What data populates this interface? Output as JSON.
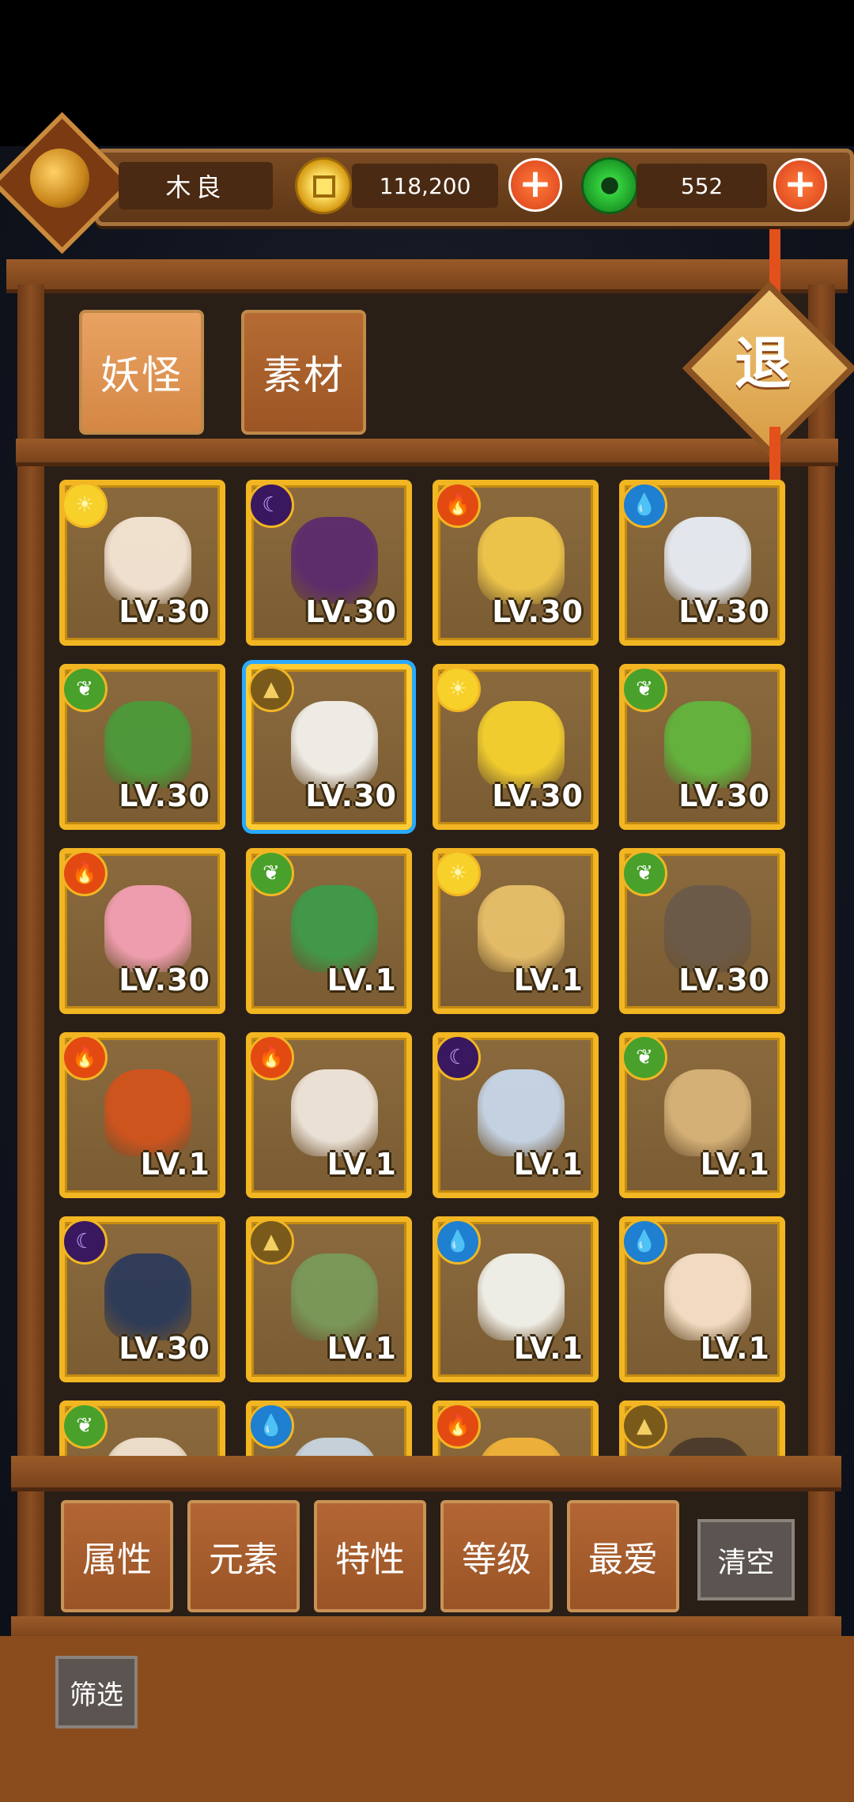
{
  "player": {
    "name": "木良"
  },
  "currencies": {
    "gold": {
      "icon": "gold-coin-icon",
      "value": "118,200"
    },
    "jade": {
      "icon": "jade-coin-icon",
      "value": "552"
    }
  },
  "tabs": [
    {
      "label": "妖怪",
      "active": true
    },
    {
      "label": "素材",
      "active": false
    }
  ],
  "exit_label": "退",
  "cards": [
    {
      "element": "sun",
      "level": "LV.30",
      "art": "#f5e6d6"
    },
    {
      "element": "moon",
      "level": "LV.30",
      "art": "#5b2a6e"
    },
    {
      "element": "fire",
      "level": "LV.30",
      "art": "#f2c84b"
    },
    {
      "element": "water",
      "level": "LV.30",
      "art": "#e8eef6"
    },
    {
      "element": "leaf",
      "level": "LV.30",
      "art": "#4c9a3a"
    },
    {
      "element": "earth",
      "level": "LV.30",
      "art": "#f4f2ee",
      "selected": true
    },
    {
      "element": "sun",
      "level": "LV.30",
      "art": "#f6d12e"
    },
    {
      "element": "leaf",
      "level": "LV.30",
      "art": "#62b53e"
    },
    {
      "element": "fire",
      "level": "LV.30",
      "art": "#f4a0b4"
    },
    {
      "element": "leaf",
      "level": "LV.1",
      "art": "#3f9a4a"
    },
    {
      "element": "sun",
      "level": "LV.1",
      "art": "#e8c06a"
    },
    {
      "element": "leaf",
      "level": "LV.30",
      "art": "#6b5a4a"
    },
    {
      "element": "fire",
      "level": "LV.1",
      "art": "#d2531d"
    },
    {
      "element": "fire",
      "level": "LV.1",
      "art": "#f0e6dc"
    },
    {
      "element": "moon",
      "level": "LV.1",
      "art": "#c7d7ea"
    },
    {
      "element": "leaf",
      "level": "LV.1",
      "art": "#d8b47a"
    },
    {
      "element": "moon",
      "level": "LV.30",
      "art": "#2b3a5a"
    },
    {
      "element": "earth",
      "level": "LV.1",
      "art": "#7a9a5a"
    },
    {
      "element": "water",
      "level": "LV.1",
      "art": "#f4f4ee"
    },
    {
      "element": "water",
      "level": "LV.1",
      "art": "#f7e0c8"
    },
    {
      "element": "leaf",
      "level": "",
      "art": "#f0e2d0"
    },
    {
      "element": "water",
      "level": "",
      "art": "#c9d6e0"
    },
    {
      "element": "fire",
      "level": "",
      "art": "#f2b33a"
    },
    {
      "element": "earth",
      "level": "",
      "art": "#4a3a2a"
    }
  ],
  "filters": [
    "属性",
    "元素",
    "特性",
    "等级",
    "最爱"
  ],
  "clear_label": "清空",
  "screen_label": "筛选",
  "colors": {
    "card_border": "#f2b623",
    "select_glow": "#2aa9ff",
    "wood": "#8a4c1d"
  }
}
